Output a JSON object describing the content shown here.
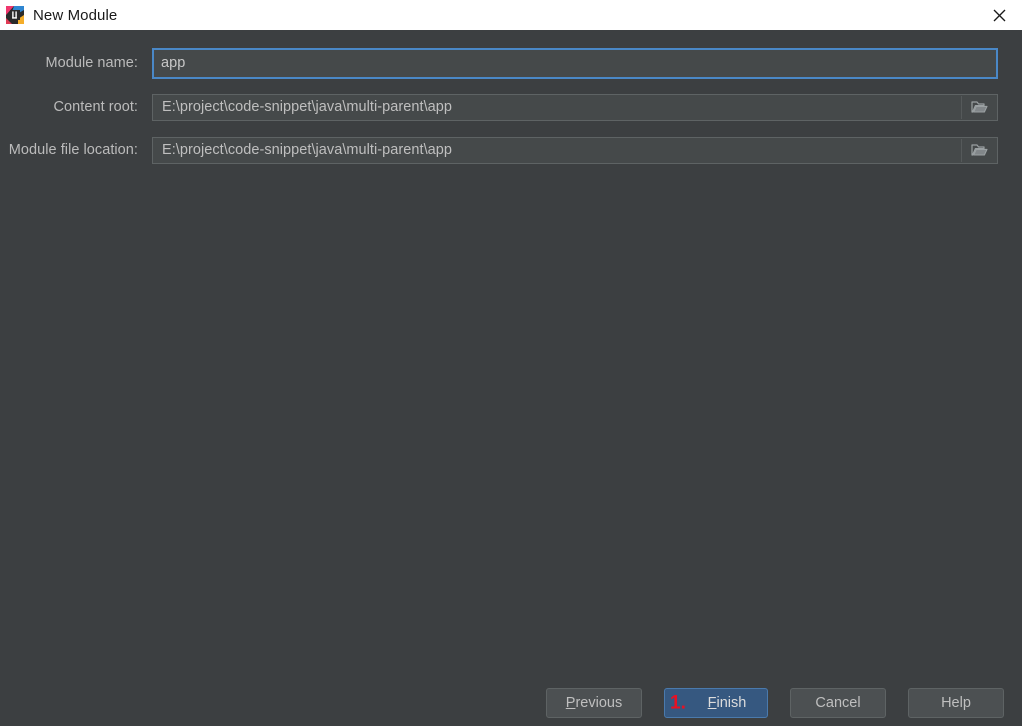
{
  "window": {
    "title": "New Module",
    "app_icon": "intellij-idea-icon",
    "close_icon": "close-icon",
    "background_color": "#3c3f41",
    "titlebar_background_color": "#ffffff"
  },
  "form": {
    "rows": [
      {
        "label": "Module name:",
        "value": "app",
        "field_type": "text",
        "focused": true,
        "browse_icon": null
      },
      {
        "label": "Content root:",
        "value": "E:\\project\\code-snippet\\java\\multi-parent\\app",
        "field_type": "path",
        "focused": false,
        "browse_icon": "folder-icon"
      },
      {
        "label": "Module file location:",
        "value": "E:\\project\\code-snippet\\java\\multi-parent\\app",
        "field_type": "path",
        "focused": false,
        "browse_icon": "folder-icon"
      }
    ],
    "focus_border_color": "#4a88c7",
    "field_background_color": "#45494a"
  },
  "buttons": {
    "previous": {
      "label": "Previous",
      "mnemonic": "P",
      "before": "",
      "after": "revious"
    },
    "finish": {
      "label": "Finish",
      "mnemonic": "F",
      "before": "",
      "after": "inish",
      "default": true,
      "accent_color": "#365880"
    },
    "cancel": {
      "label": "Cancel"
    },
    "help": {
      "label": "Help"
    }
  },
  "annotations": {
    "finish_marker": "1.",
    "marker_color": "#e81123"
  }
}
